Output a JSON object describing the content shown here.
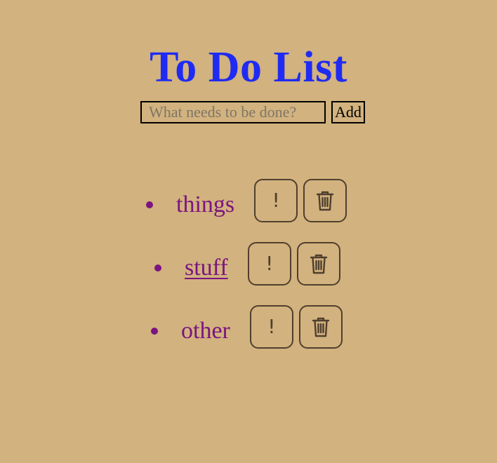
{
  "header": {
    "title": "To Do List"
  },
  "form": {
    "placeholder": "What needs to be done?",
    "value": "",
    "add_label": "Add"
  },
  "todos": [
    {
      "text": "things",
      "underlined": false,
      "priority_label": "!",
      "delete_icon": "trash-icon"
    },
    {
      "text": "stuff",
      "underlined": true,
      "priority_label": "!",
      "delete_icon": "trash-icon"
    },
    {
      "text": "other",
      "underlined": false,
      "priority_label": "!",
      "delete_icon": "trash-icon"
    }
  ],
  "colors": {
    "background": "#d2b27e",
    "title": "#1f2bf2",
    "todo_text": "#7b1480",
    "button_border": "#4f3f2e"
  }
}
